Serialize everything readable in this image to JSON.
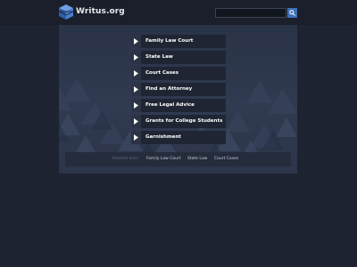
{
  "header": {
    "site_name": "Writus.org",
    "search": {
      "value": "",
      "placeholder": ""
    },
    "search_button_icon": "search-icon"
  },
  "menu": {
    "items": [
      {
        "label": "Family Law Court"
      },
      {
        "label": "State Law"
      },
      {
        "label": "Court Cases"
      },
      {
        "label": "Find an Attorney"
      },
      {
        "label": "Free Legal Advice"
      },
      {
        "label": "Grants for College Students"
      },
      {
        "label": "Garnishment"
      }
    ],
    "item_icon": "chevron-right-icon"
  },
  "related": {
    "title": "Related links",
    "links": [
      "Family Law Court",
      "State Law",
      "Court Cases"
    ]
  },
  "colors": {
    "background": "#1d2330",
    "panel": "#2d364b",
    "menu_item": "#1f2533",
    "accent_blue": "#3f6fb6"
  }
}
